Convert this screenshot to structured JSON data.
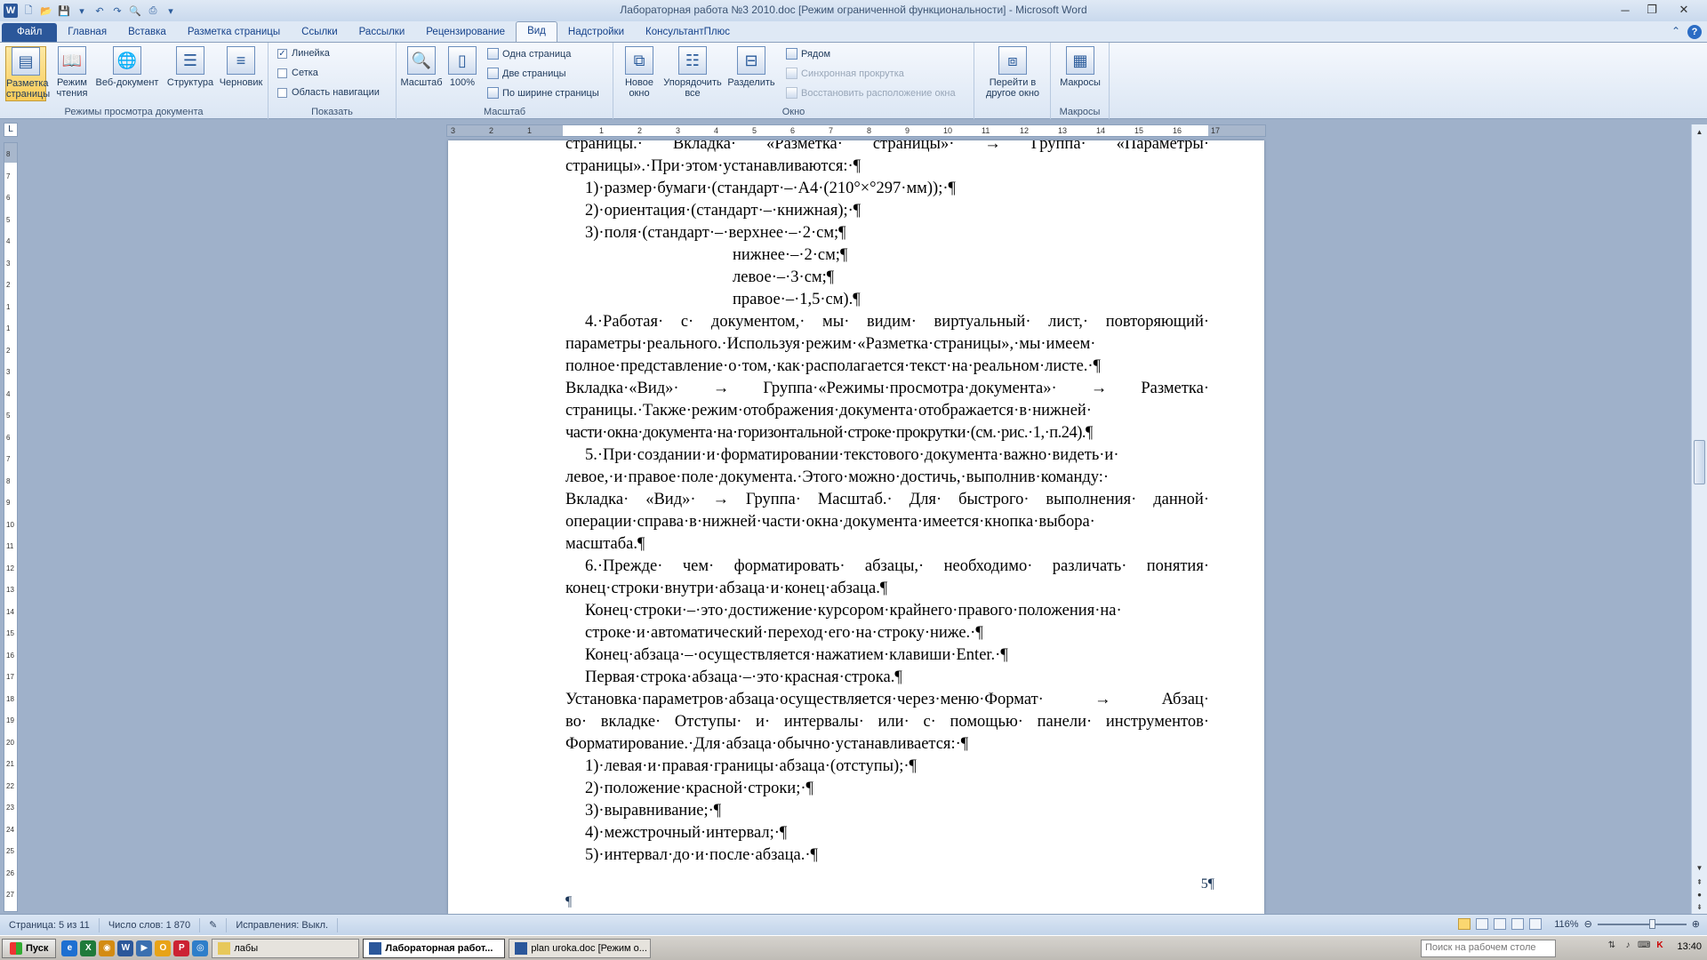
{
  "window": {
    "title": "Лабораторная работа №3 2010.doc [Режим ограниченной функциональности] - Microsoft Word"
  },
  "tabs": [
    "Файл",
    "Главная",
    "Вставка",
    "Разметка страницы",
    "Ссылки",
    "Рассылки",
    "Рецензирование",
    "Вид",
    "Надстройки",
    "КонсультантПлюс"
  ],
  "ribbon": {
    "groups": {
      "views": "Режимы просмотра документа",
      "show": "Показать",
      "zoom": "Масштаб",
      "window": "Окно",
      "macros": "Макросы"
    },
    "views": {
      "print_layout": "Разметка страницы",
      "reading": "Режим чтения",
      "web": "Веб-документ",
      "outline": "Структура",
      "draft": "Черновик"
    },
    "show": {
      "ruler": "Линейка",
      "grid": "Сетка",
      "navigation": "Область навигации"
    },
    "zoom": {
      "zoom": "Масштаб",
      "percent": "100%",
      "one_page": "Одна страница",
      "two_pages": "Две страницы",
      "page_width": "По ширине страницы"
    },
    "window": {
      "new_window": "Новое окно",
      "arrange_all": "Упорядочить все",
      "split": "Разделить",
      "side_by_side": "Рядом",
      "sync_scroll": "Синхронная прокрутка",
      "reset_position": "Восстановить расположение окна",
      "switch_windows": "Перейти в другое окно"
    },
    "macros": {
      "macros": "Макросы"
    }
  },
  "ruler_ticks": [
    "3",
    "2",
    "1",
    "1",
    "2",
    "3",
    "4",
    "5",
    "6",
    "7",
    "8",
    "9",
    "10",
    "11",
    "12",
    "13",
    "14",
    "15",
    "16",
    "17"
  ],
  "vruler_ticks": [
    "8",
    "7",
    "6",
    "5",
    "4",
    "3",
    "2",
    "1",
    "1",
    "2",
    "3",
    "4",
    "5",
    "6",
    "7",
    "8",
    "9",
    "10",
    "11",
    "12",
    "13",
    "14",
    "15",
    "16",
    "17",
    "18",
    "19",
    "20",
    "21",
    "22",
    "23",
    "24",
    "25",
    "26",
    "27"
  ],
  "document": {
    "lines": [
      "страницы.· Вкладка· «Разметка· страницы»· → Группа· «Параметры·",
      "страницы».·При·этом·устанавливаются:·¶",
      "1)·размер·бумаги·(стандарт·–·А4·(210°×°297·мм));·¶",
      "2)·ориентация·(стандарт·–·книжная);·¶",
      "3)·поля·(стандарт·–·верхнее·–·2·см;¶",
      "нижнее·–·2·см;¶",
      "левое·–·3·см;¶",
      "правое·–·1,5·см).¶",
      "4.·Работая· с· документом,· мы· видим· виртуальный· лист,· повторяющий·",
      "параметры·реального.·Используя·режим·«Разметка·страницы»,·мы·имеем·",
      "полное·представление·о·том,·как·располагается·текст·на·реальном·листе.·¶",
      "Вкладка·«Вид»· → Группа·«Режимы·просмотра·документа»· → Разметка·",
      "страницы.·Также·режим·отображения·документа·отображается·в·нижней·",
      "части·окна·документа·на·горизонтальной·строке·прокрутки·(см.·рис.·1,·п.24).¶",
      "5.·При·создании·и·форматировании·текстового·документа·важно·видеть·и·",
      "левое,·и·правое·поле·документа.·Этого·можно·достичь,·выполнив·команду:·",
      "Вкладка· «Вид»· → Группа· Масштаб.· Для· быстрого· выполнения· данной·",
      "операции·справа·в·нижней·части·окна·документа·имеется·кнопка·выбора·",
      "масштаба.¶",
      "6.·Прежде· чем· форматировать· абзацы,· необходимо· различать· понятия·",
      "конец·строки·внутри·абзаца·и·конец·абзаца.¶",
      "Конец·строки·–·это·достижение·курсором·крайнего·правого·положения·на·",
      "строке·и·автоматический·переход·его·на·строку·ниже.·¶",
      "Конец·абзаца·–·осуществляется·нажатием·клавиши·Enter.·¶",
      "Первая·строка·абзаца·–·это·красная·строка.¶",
      "Установка·параметров·абзаца·осуществляется·через·меню·Формат· → Абзац·",
      "во· вкладке· Отступы· и· интервалы· или· с· помощью· панели· инструментов·",
      "Форматирование.·Для·абзаца·обычно·устанавливается:·¶",
      "1)·левая·и·правая·границы·абзаца·(отступы);·¶",
      "2)·положение·красной·строки;·¶",
      "3)·выравнивание;·¶",
      "4)·межстрочный·интервал;·¶",
      "5)·интервал·до·и·после·абзаца.·¶"
    ],
    "page_number": "5¶",
    "trailing_mark": "¶"
  },
  "status": {
    "page": "Страница: 5 из 11",
    "words": "Число слов: 1 870",
    "track": "Исправления: Выкл.",
    "zoom": "116%"
  },
  "taskbar": {
    "start": "Пуск",
    "folder": "лабы",
    "task1": "Лабораторная работ...",
    "task2": "plan uroka.doc [Режим о...",
    "search_placeholder": "Поиск на рабочем столе",
    "clock": "13:40"
  }
}
